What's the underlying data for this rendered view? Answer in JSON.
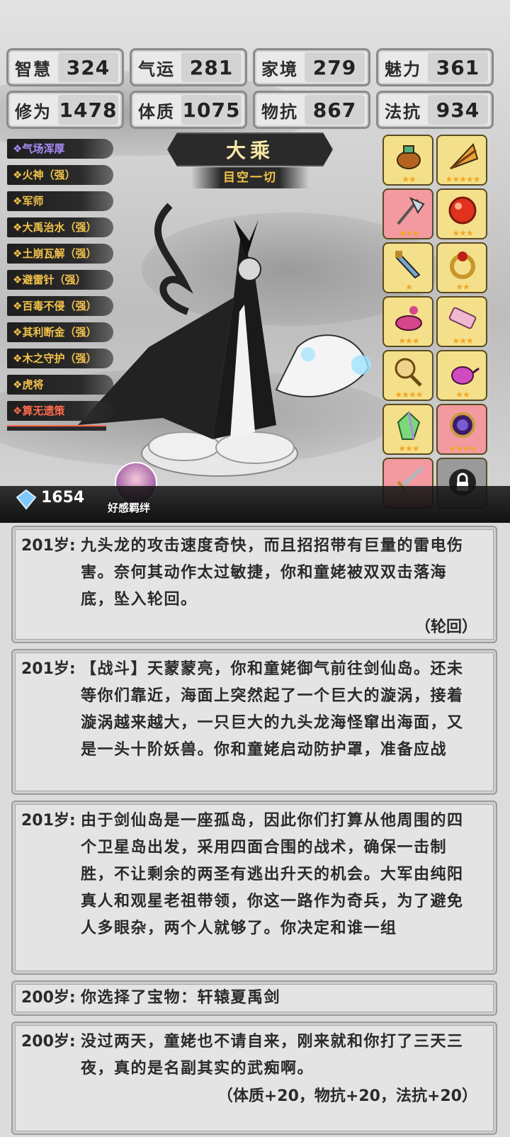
{
  "stats": [
    {
      "label": "智慧",
      "value": "324"
    },
    {
      "label": "气运",
      "value": "281"
    },
    {
      "label": "家境",
      "value": "279"
    },
    {
      "label": "魅力",
      "value": "361"
    },
    {
      "label": "修为",
      "value": "1478"
    },
    {
      "label": "体质",
      "value": "1075"
    },
    {
      "label": "物抗",
      "value": "867"
    },
    {
      "label": "法抗",
      "value": "934"
    }
  ],
  "traits": [
    {
      "label": "❖气场浑厚",
      "color": "purple"
    },
    {
      "label": "❖火神（强）",
      "color": "gold"
    },
    {
      "label": "❖军师",
      "color": "gold"
    },
    {
      "label": "❖大禹治水（强）",
      "color": "gold"
    },
    {
      "label": "❖土崩瓦解（强）",
      "color": "gold"
    },
    {
      "label": "❖避雷针（强）",
      "color": "gold"
    },
    {
      "label": "❖百毒不侵（强）",
      "color": "gold"
    },
    {
      "label": "❖其利断金（强）",
      "color": "gold"
    },
    {
      "label": "❖木之守护（强）",
      "color": "gold"
    },
    {
      "label": "❖虎将",
      "color": "gold"
    },
    {
      "label": "❖算无遗策",
      "color": "red"
    }
  ],
  "realm": {
    "title": "大乘",
    "subtitle": "目空一切"
  },
  "items": [
    {
      "icon": "incense-burner-icon",
      "stars": "★★",
      "bg": "gold"
    },
    {
      "icon": "fan-icon",
      "stars": "★★★★★",
      "bg": "gold"
    },
    {
      "icon": "axe-icon",
      "stars": "★★★",
      "bg": "pink"
    },
    {
      "icon": "red-orb-icon",
      "stars": "★★★",
      "bg": "gold"
    },
    {
      "icon": "dagger-icon",
      "stars": "★",
      "bg": "gold"
    },
    {
      "icon": "ring-icon",
      "stars": "★★",
      "bg": "gold"
    },
    {
      "icon": "gourd-bowl-icon",
      "stars": "★★★",
      "bg": "gold"
    },
    {
      "icon": "scroll-icon",
      "stars": "★★★",
      "bg": "gold"
    },
    {
      "icon": "mirror-icon",
      "stars": "★★★★",
      "bg": "gold"
    },
    {
      "icon": "teapot-icon",
      "stars": "★★",
      "bg": "gold"
    },
    {
      "icon": "crystal-icon",
      "stars": "★★★",
      "bg": "gold"
    },
    {
      "icon": "purple-mirror-icon",
      "stars": "★★★★",
      "bg": "pink"
    },
    {
      "icon": "sword-icon",
      "stars": "★★★",
      "bg": "pink"
    },
    {
      "icon": "lock-icon",
      "stars": "",
      "bg": "gray"
    }
  ],
  "currency": {
    "gems": "1654"
  },
  "favor_label": "好感羁绊",
  "log": [
    {
      "age": "201岁:",
      "text": "九头龙的攻击速度奇快，而且招招带有巨量的雷电伤害。奈何其动作太过敏捷，你和童姥被双双击落海底，坠入轮回。",
      "tail": "（轮回）"
    },
    {
      "age": "201岁:",
      "text": "【战斗】天蒙蒙亮，你和童姥御气前往剑仙岛。还未等你们靠近，海面上突然起了一个巨大的漩涡，接着漩涡越来越大，一只巨大的九头龙海怪窜出海面，又是一头十阶妖兽。你和童姥启动防护罩，准备应战",
      "tail": ""
    },
    {
      "age": "201岁:",
      "text": "由于剑仙岛是一座孤岛，因此你们打算从他周围的四个卫星岛出发，采用四面合围的战术，确保一击制胜，不让剩余的两圣有逃出升天的机会。大军由纯阳真人和观星老祖带领，你这一路作为奇兵，为了避免人多眼杂，两个人就够了。你决定和谁一组",
      "tail": ""
    },
    {
      "age": "200岁:",
      "text": "你选择了宝物：轩辕夏禹剑",
      "tail": ""
    },
    {
      "age": "200岁:",
      "text": "没过两天，童姥也不请自来，刚来就和你打了三天三夜，真的是名副其实的武痴啊。",
      "tail": "（体质+20，物抗+20，法抗+20）"
    }
  ]
}
